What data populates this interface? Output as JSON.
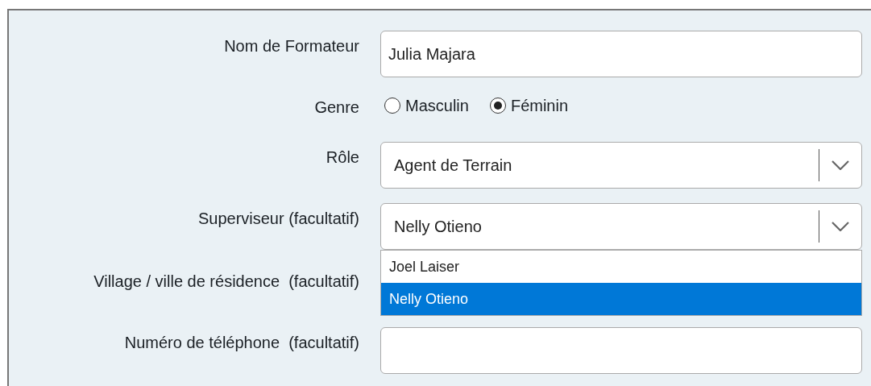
{
  "form": {
    "fields": [
      {
        "kind": "text",
        "label": "Nom de Formateur",
        "value": "Julia Majara"
      },
      {
        "kind": "radio",
        "label": "Genre",
        "options": [
          {
            "label": "Masculin",
            "selected": false
          },
          {
            "label": "Féminin",
            "selected": true
          }
        ]
      },
      {
        "kind": "select",
        "label": "Rôle",
        "value": "Agent de Terrain"
      },
      {
        "kind": "select",
        "label": "Superviseur (facultatif)",
        "value": "Nelly Otieno",
        "expanded": true,
        "options": [
          {
            "label": "Joel Laiser",
            "selected": false
          },
          {
            "label": "Nelly Otieno",
            "selected": true
          }
        ]
      },
      {
        "kind": "hidden",
        "label": "Village / ville de résidence  (facultatif)"
      },
      {
        "kind": "text",
        "label": "Numéro de téléphone  (facultatif)"
      }
    ]
  }
}
